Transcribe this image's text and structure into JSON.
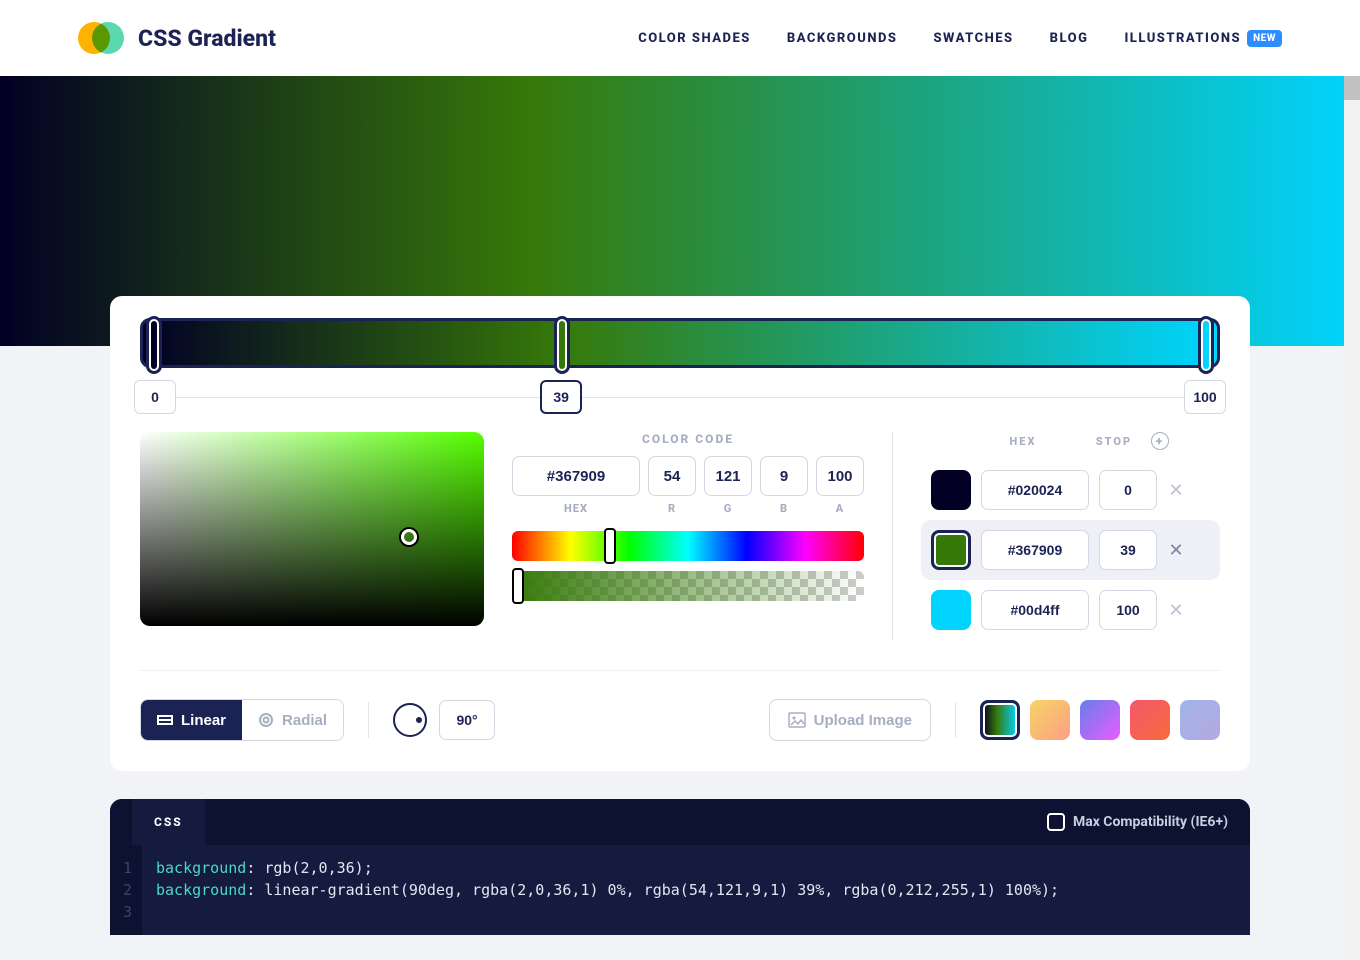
{
  "header": {
    "title": "CSS Gradient",
    "nav": [
      "COLOR SHADES",
      "BACKGROUNDS",
      "SWATCHES",
      "BLOG",
      "ILLUSTRATIONS"
    ],
    "badge": "NEW"
  },
  "gradient": {
    "css": "linear-gradient(90deg, rgba(2,0,36,1) 0%, rgba(54,121,9,1) 39%, rgba(0,212,255,1) 100%)",
    "angle": "90°"
  },
  "slider": {
    "stops": [
      {
        "pos": "0",
        "color": "#020024"
      },
      {
        "pos": "39",
        "color": "#367909"
      },
      {
        "pos": "100",
        "color": "#00d4ff"
      }
    ],
    "active_index": 1
  },
  "color_code": {
    "label": "COLOR CODE",
    "hex": "#367909",
    "r": "54",
    "g": "121",
    "b": "9",
    "a": "100",
    "sub": {
      "hex": "HEX",
      "r": "R",
      "g": "G",
      "b": "B",
      "a": "A"
    }
  },
  "stops_table": {
    "head_hex": "HEX",
    "head_stop": "STOP",
    "rows": [
      {
        "color": "#020024",
        "hex": "#020024",
        "stop": "0",
        "active": false
      },
      {
        "color": "#367909",
        "hex": "#367909",
        "stop": "39",
        "active": true
      },
      {
        "color": "#00d4ff",
        "hex": "#00d4ff",
        "stop": "100",
        "active": false
      }
    ]
  },
  "type": {
    "linear": "Linear",
    "radial": "Radial"
  },
  "upload": "Upload Image",
  "presets": [
    {
      "bg": "linear-gradient(90deg,#020024,#367909 40%,#00d4ff)",
      "selected": true
    },
    {
      "bg": "linear-gradient(135deg,#f6d365,#fda085)",
      "selected": false
    },
    {
      "bg": "linear-gradient(135deg,#667eea,#e85dff)",
      "selected": false
    },
    {
      "bg": "linear-gradient(135deg,#f5576c,#f66b3c)",
      "selected": false
    },
    {
      "bg": "linear-gradient(135deg,#a1b5e8,#b4a8e0)",
      "selected": false
    }
  ],
  "code": {
    "tab": "CSS",
    "compat": "Max Compatibility (IE6+)",
    "line1a": "background",
    "line1b": ": rgb(2,0,36);",
    "line2a": "background",
    "line2b": ": linear-gradient(90deg, rgba(2,0,36,1) 0%, rgba(54,121,9,1) 39%, rgba(0,212,255,1) 100%);"
  }
}
